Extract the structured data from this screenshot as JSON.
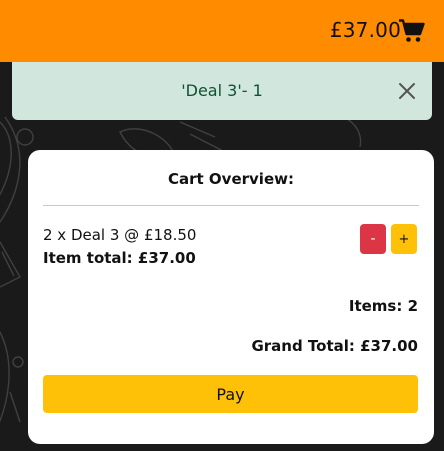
{
  "header": {
    "cart_total": "£37.00",
    "cart_icon": "shopping-cart-icon",
    "background_color": "#ff8c00"
  },
  "alert": {
    "message": "'Deal 3'- 1",
    "close_icon": "close-icon",
    "background_color": "#d1e7dd",
    "text_color": "#0f5132"
  },
  "cart": {
    "title": "Cart Overview:",
    "items": [
      {
        "line": "2 x Deal 3 @ £18.50",
        "total_label": "Item total: £37.00",
        "minus_label": "-",
        "plus_label": "+"
      }
    ],
    "items_count_label": "Items: 2",
    "grand_total_label": "Grand Total: £37.00",
    "pay_label": "Pay"
  },
  "colors": {
    "minus_button": "#dc3545",
    "plus_button": "#ffc107",
    "pay_button": "#ffc107"
  }
}
